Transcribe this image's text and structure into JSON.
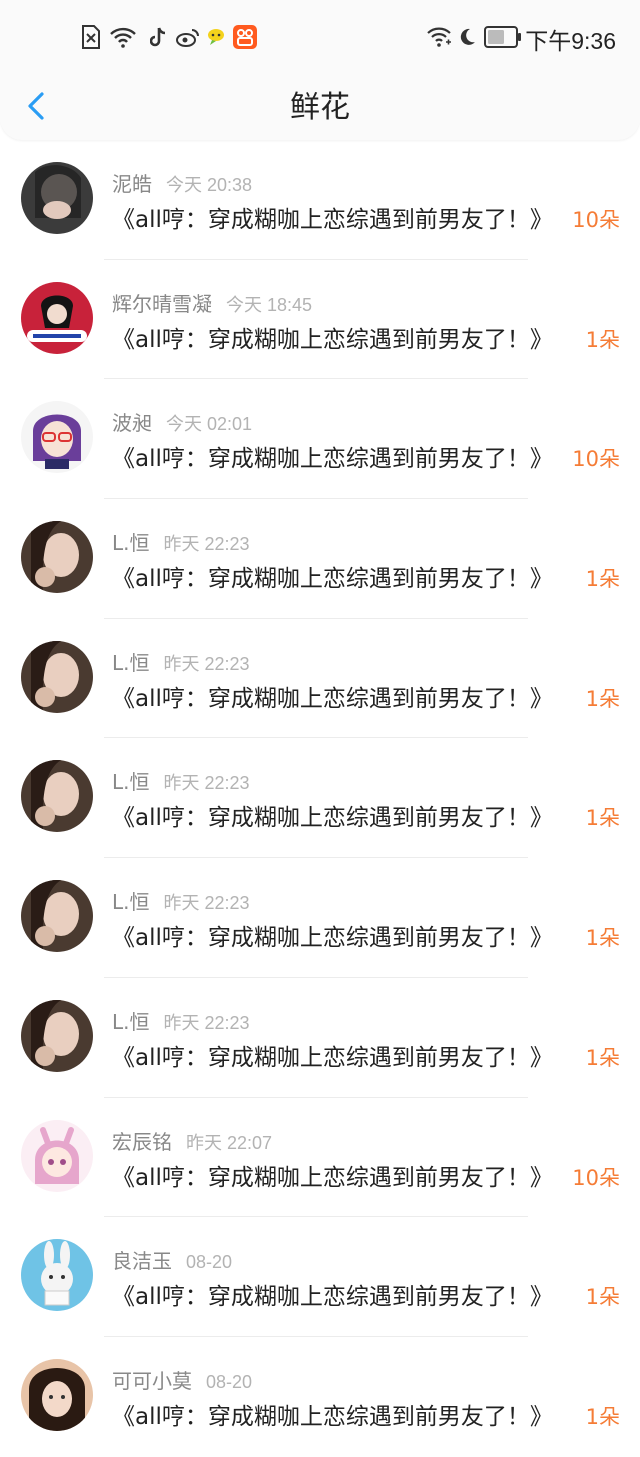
{
  "status_bar": {
    "time": "下午9:36",
    "left_icons": [
      "sim-none-icon",
      "wifi-icon",
      "tiktok-icon",
      "weibo-icon",
      "chat-app-icon",
      "kuaishou-icon"
    ],
    "right_icons": [
      "wifi-signal-icon",
      "moon-icon",
      "battery-icon"
    ]
  },
  "nav": {
    "title": "鲜花",
    "back_icon": "chevron-left-icon"
  },
  "accent_color": "#f57c36",
  "list": [
    {
      "name": "泥皓",
      "time": "今天 20:38",
      "book": "《all哼：穿成糊咖上恋综遇到前男友了！》",
      "count": "10朵"
    },
    {
      "name": "辉尔晴雪凝",
      "time": "今天 18:45",
      "book": "《all哼：穿成糊咖上恋综遇到前男友了！》",
      "count": "1朵"
    },
    {
      "name": "波昶",
      "time": "今天 02:01",
      "book": "《all哼：穿成糊咖上恋综遇到前男友了！》",
      "count": "10朵"
    },
    {
      "name": "L.恒",
      "time": "昨天 22:23",
      "book": "《all哼：穿成糊咖上恋综遇到前男友了！》",
      "count": "1朵"
    },
    {
      "name": "L.恒",
      "time": "昨天 22:23",
      "book": "《all哼：穿成糊咖上恋综遇到前男友了！》",
      "count": "1朵"
    },
    {
      "name": "L.恒",
      "time": "昨天 22:23",
      "book": "《all哼：穿成糊咖上恋综遇到前男友了！》",
      "count": "1朵"
    },
    {
      "name": "L.恒",
      "time": "昨天 22:23",
      "book": "《all哼：穿成糊咖上恋综遇到前男友了！》",
      "count": "1朵"
    },
    {
      "name": "L.恒",
      "time": "昨天 22:23",
      "book": "《all哼：穿成糊咖上恋综遇到前男友了！》",
      "count": "1朵"
    },
    {
      "name": "宏辰铭",
      "time": "昨天 22:07",
      "book": "《all哼：穿成糊咖上恋综遇到前男友了！》",
      "count": "10朵"
    },
    {
      "name": "良洁玉",
      "time": "08-20",
      "book": "《all哼：穿成糊咖上恋综遇到前男友了！》",
      "count": "1朵"
    },
    {
      "name": "可可小莫",
      "time": "08-20",
      "book": "《all哼：穿成糊咖上恋综遇到前男友了！》",
      "count": "1朵"
    }
  ]
}
